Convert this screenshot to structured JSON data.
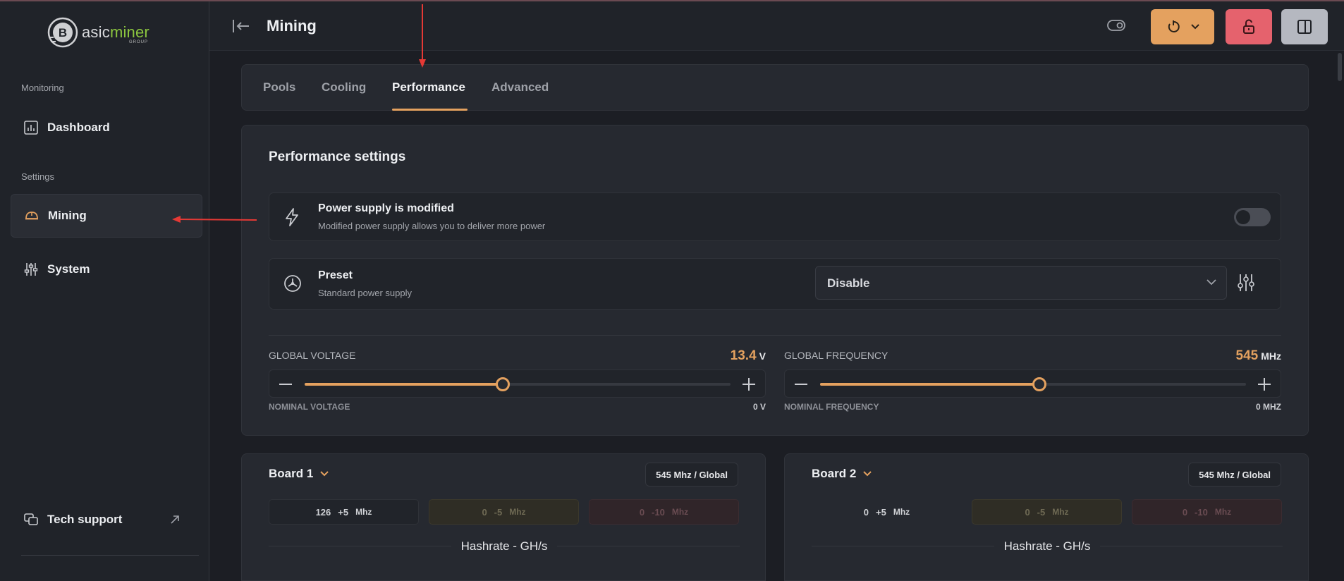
{
  "brand": {
    "name_prefix": "asic",
    "name_suffix": "miner",
    "group": "GROUP"
  },
  "sidebar": {
    "section_monitoring": "Monitoring",
    "section_settings": "Settings",
    "items": [
      {
        "label": "Dashboard",
        "icon": "bar-chart-icon"
      },
      {
        "label": "Mining",
        "icon": "helmet-icon",
        "active": true
      },
      {
        "label": "System",
        "icon": "sliders-icon"
      }
    ],
    "tech_support": "Tech support"
  },
  "header": {
    "title": "Mining"
  },
  "tabs": [
    {
      "label": "Pools"
    },
    {
      "label": "Cooling"
    },
    {
      "label": "Performance",
      "active": true
    },
    {
      "label": "Advanced"
    }
  ],
  "performance": {
    "title": "Performance settings",
    "power_supply": {
      "title": "Power supply is modified",
      "subtitle": "Modified power supply allows you to deliver more power",
      "enabled": false
    },
    "preset": {
      "title": "Preset",
      "subtitle": "Standard power supply",
      "selected": "Disable"
    },
    "voltage": {
      "label": "GLOBAL VOLTAGE",
      "value": "13.4",
      "unit": "V",
      "level": 0.465,
      "nominal_label": "NOMINAL VOLTAGE",
      "nominal_value": "0 V"
    },
    "frequency": {
      "label": "GLOBAL FREQUENCY",
      "value": "545",
      "unit": "MHz",
      "level": 0.515,
      "nominal_label": "NOMINAL FREQUENCY",
      "nominal_value": "0 MHZ"
    }
  },
  "boards": [
    {
      "title": "Board 1",
      "badge": "545 Mhz / Global",
      "neutral": {
        "count": "126",
        "delta": "+5",
        "unit": "Mhz"
      },
      "warn": {
        "count": "0",
        "delta": "-5",
        "unit": "Mhz"
      },
      "bad": {
        "count": "0",
        "delta": "-10",
        "unit": "Mhz"
      },
      "hashrate_label": "Hashrate - GH/s"
    },
    {
      "title": "Board 2",
      "badge": "545 Mhz / Global",
      "neutral": {
        "count": "0",
        "delta": "+5",
        "unit": "Mhz"
      },
      "warn": {
        "count": "0",
        "delta": "-5",
        "unit": "Mhz"
      },
      "bad": {
        "count": "0",
        "delta": "-10",
        "unit": "Mhz"
      },
      "hashrate_label": "Hashrate - GH/s"
    }
  ],
  "colors": {
    "accent": "#e4a15f",
    "danger": "#e5626d",
    "annotation": "#e53935",
    "brand_green": "#8cc63f"
  }
}
